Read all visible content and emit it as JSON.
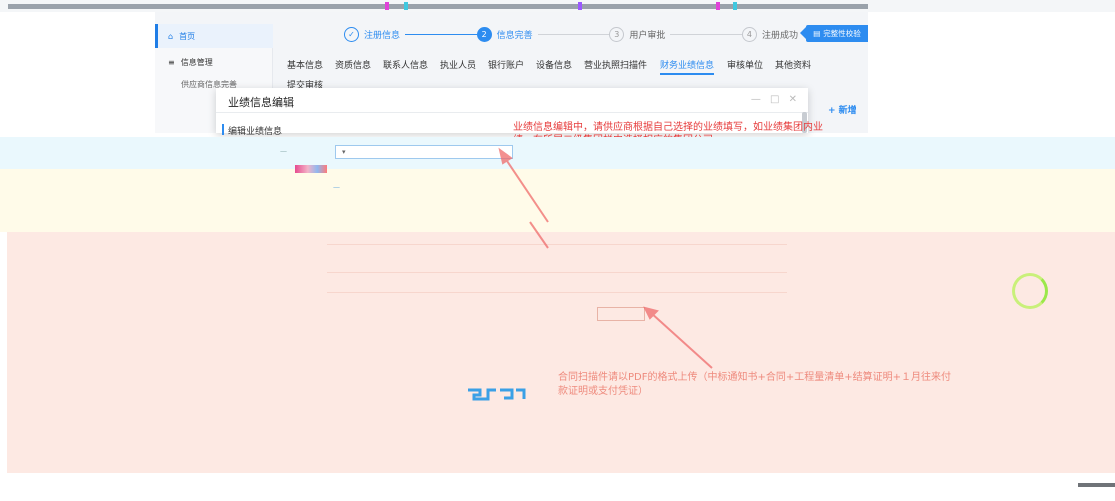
{
  "sidebar": {
    "home_label": "首页",
    "info_mgmt_label": "信息管理",
    "supplier_info_label": "供应商信息完善"
  },
  "steps": [
    {
      "num": "✓",
      "label": "注册信息",
      "state": "done"
    },
    {
      "num": "2",
      "label": "信息完善",
      "state": "active"
    },
    {
      "num": "3",
      "label": "用户审批",
      "state": "wait"
    },
    {
      "num": "4",
      "label": "注册成功",
      "state": "wait"
    }
  ],
  "completeness_check_label": "完整性校验",
  "tabs": [
    {
      "label": "基本信息"
    },
    {
      "label": "资质信息"
    },
    {
      "label": "联系人信息"
    },
    {
      "label": "执业人员"
    },
    {
      "label": "银行账户"
    },
    {
      "label": "设备信息"
    },
    {
      "label": "营业执照扫描件"
    },
    {
      "label": "财务业绩信息",
      "active": true
    },
    {
      "label": "审核单位"
    },
    {
      "label": "其他资料"
    },
    {
      "label": "提交审核"
    }
  ],
  "add_label": "+ 新增",
  "modal": {
    "title": "业绩信息编辑",
    "section_title": "编辑业绩信息",
    "controls": "— □ ✕"
  },
  "annotations": {
    "top_note": "业绩信息编辑中，请供应商根据自己选择的业绩填写，如业绩集团内业绩，在所属二级集团栏内选择相应的集团公司。",
    "bottom_note": "合同扫描件请以PDF的格式上传（中标通知书+合同+工程量清单+结算证明+１月往来付款证明或支付凭证）"
  },
  "colors": {
    "primary": "#2d8cf0",
    "annotation_red": "#e63b3b",
    "annotation_light": "#ee8a7d"
  }
}
